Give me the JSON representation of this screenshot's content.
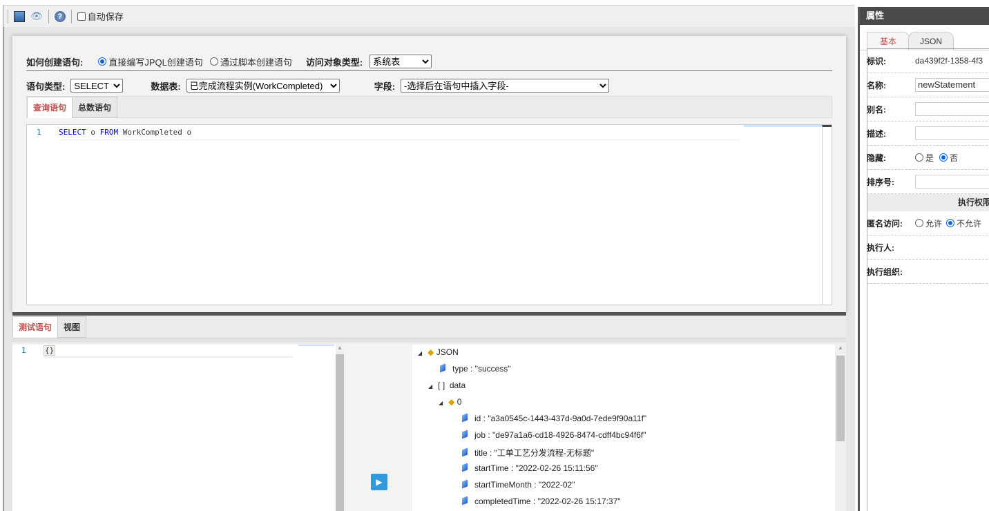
{
  "toolbar": {
    "autosave_label": "自动保存",
    "icons": [
      "save-icon",
      "preview-eye-icon",
      "help-icon"
    ]
  },
  "form": {
    "create_label": "如何创建语句:",
    "create_options": [
      "直接编写JPQL创建语句",
      "通过脚本创建语句"
    ],
    "access_label": "访问对象类型:",
    "access_value": "系统表",
    "stmt_type_label": "语句类型:",
    "stmt_type_value": "SELECT",
    "table_label": "数据表:",
    "table_value": "已完成流程实例(WorkCompleted)",
    "field_label": "字段:",
    "field_value": "-选择后在语句中插入字段-"
  },
  "query_tabs": [
    "查询语句",
    "总数语句"
  ],
  "editor": {
    "line": "1",
    "kw1": "SELECT",
    "t1": " o ",
    "kw2": "FROM",
    "t2": " WorkCompleted o"
  },
  "bottom_tabs": [
    "测试语句",
    "视图"
  ],
  "test_editor": {
    "line": "1",
    "code": "{}"
  },
  "result_tree": {
    "root": "JSON",
    "type": "type : \"success\"",
    "data": "data",
    "index": "0",
    "fields": [
      "id : \"a3a0545c-1443-437d-9a0d-7ede9f90a11f\"",
      "job : \"de97a1a6-cd18-4926-8474-cdff4bc94f6f\"",
      "title : \"工单工艺分发流程-无标题\"",
      "startTime : \"2022-02-26 15:11:56\"",
      "startTimeMonth : \"2022-02\"",
      "completedTime : \"2022-02-26 15:17:37\""
    ]
  },
  "props": {
    "title": "属性",
    "tabs": [
      "基本",
      "JSON"
    ],
    "id_label": "标识:",
    "id_value": "da439f2f-1358-4f3",
    "name_label": "名称:",
    "name_value": "newStatement",
    "alias_label": "别名:",
    "desc_label": "描述:",
    "hidden_label": "隐藏:",
    "hidden_options": [
      "是",
      "否"
    ],
    "order_label": "排序号:",
    "section": "执行权限",
    "anon_label": "匿名访问:",
    "anon_options": [
      "允许",
      "不允许"
    ],
    "executor_label": "执行人:",
    "exec_org_label": "执行组织:"
  }
}
